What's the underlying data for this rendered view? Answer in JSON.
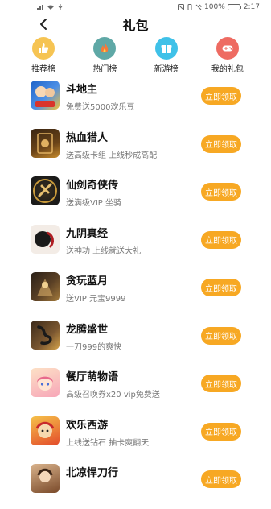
{
  "status_bar": {
    "battery": "100%",
    "time": "2:17"
  },
  "header": {
    "back_icon": "chevron-left-icon",
    "title": "礼包"
  },
  "categories": [
    {
      "label": "推荐榜",
      "icon": "thumbs-up-icon",
      "color": "#f6c453"
    },
    {
      "label": "热门榜",
      "icon": "flame-icon",
      "color": "#5fa8a6"
    },
    {
      "label": "新游榜",
      "icon": "gift-icon",
      "color": "#3fc1e8"
    },
    {
      "label": "我的礼包",
      "icon": "gamepad-icon",
      "color": "#ee6b62"
    }
  ],
  "games": [
    {
      "name": "斗地主",
      "desc": "免费送5000欢乐豆",
      "button": "立即领取",
      "colors": [
        "#1f63c7",
        "#f2c13a"
      ]
    },
    {
      "name": "热血猎人",
      "desc": "送高级卡组 上线秒成高配",
      "button": "立即领取",
      "colors": [
        "#3a2512",
        "#c58a2c"
      ]
    },
    {
      "name": "仙剑奇侠传",
      "desc": "送满级VIP 坐骑",
      "button": "立即领取",
      "colors": [
        "#1a1a1a",
        "#c99a3a"
      ]
    },
    {
      "name": "九阴真经",
      "desc": "送神功 上线就送大礼",
      "button": "立即领取",
      "colors": [
        "#f3ece6",
        "#b01d22"
      ]
    },
    {
      "name": "贪玩蓝月",
      "desc": "送VIP 元宝9999",
      "button": "立即领取",
      "colors": [
        "#2a2018",
        "#a37a3b"
      ]
    },
    {
      "name": "龙腾盛世",
      "desc": "一刀999的爽快",
      "button": "立即领取",
      "colors": [
        "#3b2a1a",
        "#d3a14a"
      ]
    },
    {
      "name": "餐厅萌物语",
      "desc": "高级召唤券x20 vip免费送",
      "button": "立即领取",
      "colors": [
        "#f7a6b8",
        "#fde1c6"
      ]
    },
    {
      "name": "欢乐西游",
      "desc": "上线送钻石 抽卡爽翻天",
      "button": "立即领取",
      "colors": [
        "#e34b2b",
        "#f6c24a"
      ]
    },
    {
      "name": "北凉悍刀行",
      "desc": "",
      "button": "立即领取",
      "colors": [
        "#d9b38c",
        "#7a4a2a"
      ]
    }
  ]
}
